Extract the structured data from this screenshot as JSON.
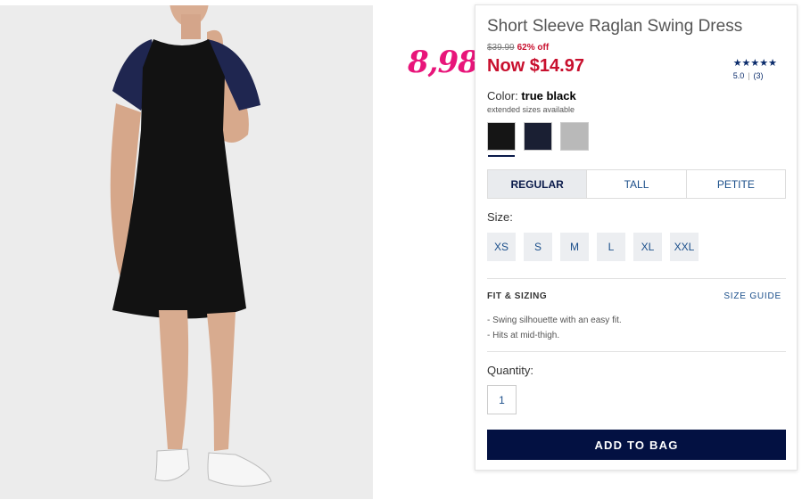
{
  "product": {
    "title": "Short Sleeve Raglan Swing Dress",
    "was_price": "$39.99",
    "discount": "62% off",
    "now_price": "Now $14.97",
    "handwritten_price": "8,98",
    "rating": {
      "stars": "★★★★★",
      "score": "5.0",
      "count": "(3)"
    },
    "color": {
      "label": "Color:",
      "value": "true black",
      "note": "extended sizes available",
      "swatches": [
        {
          "name": "true black",
          "hex": "#151515",
          "selected": true
        },
        {
          "name": "navy",
          "hex": "#1a1f33",
          "selected": false
        },
        {
          "name": "heather grey",
          "hex": "#b9b9b9",
          "selected": false
        }
      ]
    },
    "fit_tabs": [
      "REGULAR",
      "TALL",
      "PETITE"
    ],
    "size_label": "Size:",
    "sizes": [
      "XS",
      "S",
      "M",
      "L",
      "XL",
      "XXL"
    ],
    "fit_sizing": {
      "heading": "FIT & SIZING",
      "guide_link": "SIZE GUIDE",
      "bullets": [
        "- Swing silhouette with an easy fit.",
        "- Hits at mid-thigh."
      ]
    },
    "quantity": {
      "label": "Quantity:",
      "value": "1"
    },
    "add_button": "ADD TO BAG"
  },
  "colors": {
    "sale_red": "#c8102e",
    "annotation_pink": "#e8157a",
    "navy_button": "#031142",
    "link_blue": "#1a4e8a"
  }
}
